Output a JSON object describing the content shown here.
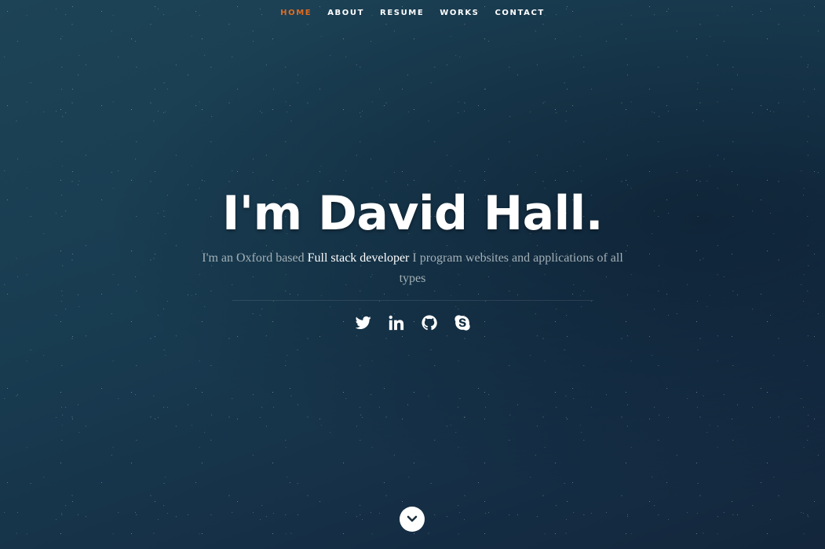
{
  "nav": {
    "items": [
      {
        "label": "HOME",
        "active": true
      },
      {
        "label": "ABOUT",
        "active": false
      },
      {
        "label": "RESUME",
        "active": false
      },
      {
        "label": "WORKS",
        "active": false
      },
      {
        "label": "CONTACT",
        "active": false
      }
    ],
    "active_color": "#e26b1e"
  },
  "hero": {
    "headline": "I'm David Hall.",
    "tagline_prefix": "I'm an Oxford based ",
    "tagline_highlight": "Full stack developer",
    "tagline_suffix": " I program websites and applications of all types"
  },
  "social": [
    {
      "icon": "twitter-icon"
    },
    {
      "icon": "linkedin-icon"
    },
    {
      "icon": "github-icon"
    },
    {
      "icon": "skype-icon"
    }
  ],
  "scroll_down": {
    "icon": "chevron-down-icon"
  }
}
